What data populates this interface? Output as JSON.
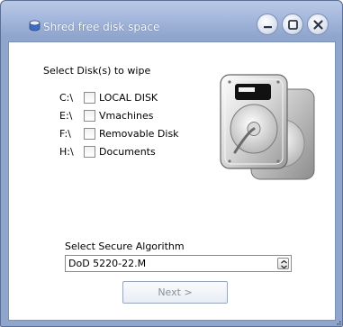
{
  "window": {
    "title": "Shred free disk space",
    "icon": "disk-shredder-icon",
    "controls": {
      "minimize_icon": "minimize-icon",
      "maximize_icon": "maximize-icon",
      "close_icon": "close-icon"
    }
  },
  "disks": {
    "heading": "Select Disk(s) to wipe",
    "items": [
      {
        "letter": "C:\\",
        "label": "LOCAL DISK",
        "checked": false
      },
      {
        "letter": "E:\\",
        "label": "Vmachines",
        "checked": false
      },
      {
        "letter": "F:\\",
        "label": "Removable Disk",
        "checked": false
      },
      {
        "letter": "H:\\",
        "label": "Documents",
        "checked": false
      }
    ]
  },
  "illustration": {
    "icon": "hard-drives-icon"
  },
  "algorithm": {
    "label": "Select Secure Algorithm",
    "selected": "DoD 5220-22.M"
  },
  "actions": {
    "next_label": "Next >",
    "next_enabled": false
  },
  "colors": {
    "window_frame": "#8fa5cb",
    "client_bg": "#ffffff",
    "disabled_text": "#8a8f99"
  }
}
